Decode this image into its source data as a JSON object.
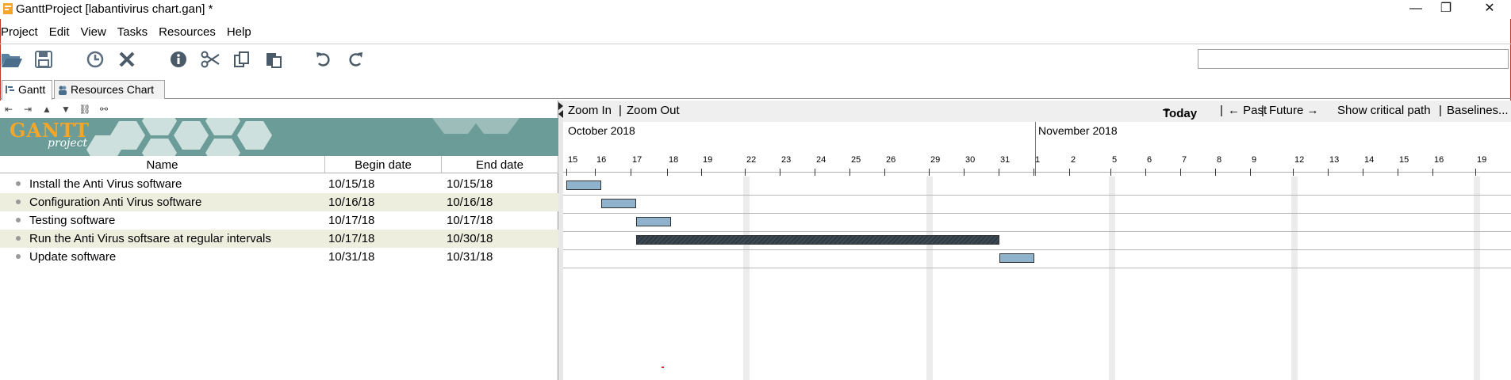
{
  "window": {
    "title": "GanttProject [labantivirus chart.gan] *",
    "controls": {
      "minimize": "—",
      "maximize": "❐",
      "close": "✕"
    }
  },
  "menu": {
    "items": [
      {
        "label": "Project",
        "mnemonic": "P"
      },
      {
        "label": "Edit",
        "mnemonic": "E"
      },
      {
        "label": "View",
        "mnemonic": "V"
      },
      {
        "label": "Tasks",
        "mnemonic": "T"
      },
      {
        "label": "Resources",
        "mnemonic": "R"
      },
      {
        "label": "Help",
        "mnemonic": "H"
      }
    ]
  },
  "toolbar": {
    "icons": [
      "open-folder-icon",
      "save-icon",
      "clock-icon",
      "delete-icon",
      "info-icon",
      "cut-icon",
      "copy-icon",
      "paste-icon",
      "undo-icon",
      "redo-icon"
    ],
    "search_value": ""
  },
  "tabs": [
    {
      "label": "Gantt",
      "active": true
    },
    {
      "label": "Resources Chart",
      "active": false
    }
  ],
  "task_panel": {
    "logo_text": "GANTT",
    "logo_sub": "project",
    "columns": [
      "Name",
      "Begin date",
      "End date"
    ],
    "rows": [
      {
        "name": "Install the Anti Virus software",
        "begin": "10/15/18",
        "end": "10/15/18"
      },
      {
        "name": "Configuration Anti Virus software",
        "begin": "10/16/18",
        "end": "10/16/18"
      },
      {
        "name": "Testing software",
        "begin": "10/17/18",
        "end": "10/17/18"
      },
      {
        "name": "Run the Anti Virus softsare at regular intervals",
        "begin": "10/17/18",
        "end": "10/30/18"
      },
      {
        "name": "Update software",
        "begin": "10/31/18",
        "end": "10/31/18"
      }
    ]
  },
  "gantt": {
    "zoom_in": "Zoom In",
    "zoom_out": "Zoom Out",
    "today": "Today",
    "past": "← Past",
    "future": "Future →",
    "critical_path": "Show critical path",
    "baselines": "Baselines...",
    "months": [
      {
        "label": "October 2018"
      },
      {
        "label": "November 2018"
      }
    ],
    "days": [
      "15",
      "16",
      "17",
      "18",
      "19",
      "22",
      "23",
      "24",
      "25",
      "26",
      "29",
      "30",
      "31",
      "1",
      "2",
      "5",
      "6",
      "7",
      "8",
      "9",
      "12",
      "13",
      "14",
      "15",
      "16",
      "19"
    ],
    "bar_colors": {
      "normal": "#8fb3cc",
      "summary": "#3e4a55"
    }
  }
}
